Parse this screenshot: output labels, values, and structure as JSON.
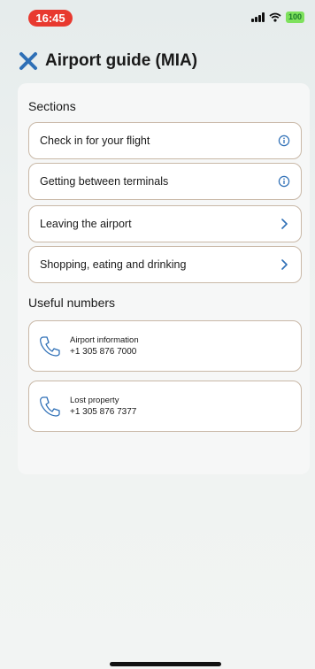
{
  "status_bar": {
    "time": "16:45",
    "battery": "100"
  },
  "header": {
    "title": "Airport guide (MIA)",
    "close_icon": "close-x-icon",
    "accent_color": "#2e6fb6"
  },
  "sections": {
    "heading": "Sections",
    "items": [
      {
        "label": "Check in for your flight",
        "icon": "info-icon"
      },
      {
        "label": "Getting between terminals",
        "icon": "info-icon"
      },
      {
        "label": "Leaving the airport",
        "icon": "chevron-right-icon"
      },
      {
        "label": "Shopping, eating and drinking",
        "icon": "chevron-right-icon"
      }
    ]
  },
  "useful_numbers": {
    "heading": "Useful numbers",
    "items": [
      {
        "name": "Airport information",
        "number": "+1 305 876 7000",
        "icon": "phone-icon"
      },
      {
        "name": "Lost property",
        "number": "+1 305 876 7377",
        "icon": "phone-icon"
      }
    ]
  }
}
